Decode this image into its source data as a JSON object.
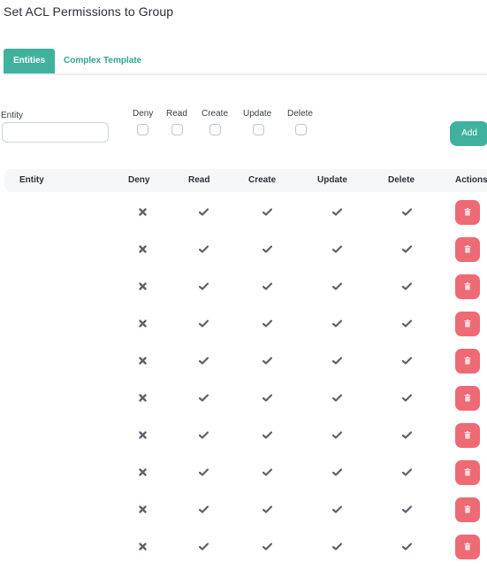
{
  "page": {
    "title": "Set ACL Permissions to Group"
  },
  "tabs": [
    {
      "label": "Entities",
      "active": true
    },
    {
      "label": "Complex Template",
      "active": false
    }
  ],
  "form": {
    "entity_label": "Entity",
    "entity_value": "",
    "entity_placeholder": "",
    "permissions": [
      {
        "label": "Deny",
        "checked": false
      },
      {
        "label": "Read",
        "checked": false
      },
      {
        "label": "Create",
        "checked": false
      },
      {
        "label": "Update",
        "checked": false
      },
      {
        "label": "Delete",
        "checked": false
      }
    ],
    "add_label": "Add"
  },
  "table": {
    "columns": [
      "Entity",
      "Deny",
      "Read",
      "Create",
      "Update",
      "Delete",
      "Actions"
    ],
    "rows": [
      {
        "entity": "",
        "deny": false,
        "read": true,
        "create": true,
        "update": true,
        "delete": true
      },
      {
        "entity": "",
        "deny": false,
        "read": true,
        "create": true,
        "update": true,
        "delete": true
      },
      {
        "entity": "",
        "deny": false,
        "read": true,
        "create": true,
        "update": true,
        "delete": true
      },
      {
        "entity": "",
        "deny": false,
        "read": true,
        "create": true,
        "update": true,
        "delete": true
      },
      {
        "entity": "",
        "deny": false,
        "read": true,
        "create": true,
        "update": true,
        "delete": true
      },
      {
        "entity": "",
        "deny": false,
        "read": true,
        "create": true,
        "update": true,
        "delete": true
      },
      {
        "entity": "",
        "deny": false,
        "read": true,
        "create": true,
        "update": true,
        "delete": true
      },
      {
        "entity": "",
        "deny": false,
        "read": true,
        "create": true,
        "update": true,
        "delete": true
      },
      {
        "entity": "",
        "deny": false,
        "read": true,
        "create": true,
        "update": true,
        "delete": true
      },
      {
        "entity": "",
        "deny": false,
        "read": true,
        "create": true,
        "update": true,
        "delete": true
      }
    ],
    "icons": {
      "true": "check-icon",
      "false": "x-icon",
      "action": "trash-icon"
    }
  },
  "colors": {
    "accent": "#3fb19e",
    "danger": "#ee6a75",
    "icon": "#5a626b"
  }
}
